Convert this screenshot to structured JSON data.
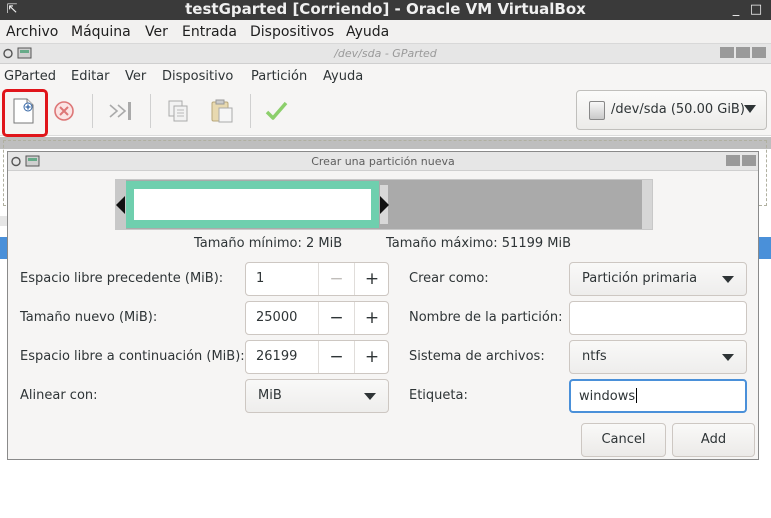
{
  "vbox": {
    "title": "testGparted [Corriendo] - Oracle VM VirtualBox",
    "menu": [
      "Archivo",
      "Máquina",
      "Ver",
      "Entrada",
      "Dispositivos",
      "Ayuda"
    ]
  },
  "gparted": {
    "title": "/dev/sda - GParted",
    "menu": [
      "GParted",
      "Editar",
      "Ver",
      "Dispositivo",
      "Partición",
      "Ayuda"
    ],
    "toolbar_icons": [
      "new-partition-icon",
      "delete-icon",
      "resize-move-icon",
      "copy-icon",
      "paste-icon",
      "apply-icon"
    ],
    "device": "/dev/sda (50.00 GiB)"
  },
  "dialog": {
    "title": "Crear una partición nueva",
    "min_size": "Tamaño mínimo: 2 MiB",
    "max_size": "Tamaño máximo: 51199 MiB",
    "left": {
      "free_before_label": "Espacio libre precedente (MiB):",
      "free_before_value": "1",
      "new_size_label": "Tamaño nuevo (MiB):",
      "new_size_value": "25000",
      "free_after_label": "Espacio libre a continuación (MiB):",
      "free_after_value": "26199",
      "align_label": "Alinear con:",
      "align_value": "MiB"
    },
    "right": {
      "create_as_label": "Crear como:",
      "create_as_value": "Partición primaria",
      "part_name_label": "Nombre de la partición:",
      "part_name_value": "",
      "filesystem_label": "Sistema de archivos:",
      "filesystem_value": "ntfs",
      "label_label": "Etiqueta:",
      "label_value": "windows"
    },
    "cancel_label": "Cancel",
    "add_label": "Add",
    "partition_fill": 0.488
  },
  "colors": {
    "new_partition": "#6fcfae",
    "highlight": "#e0151b",
    "selection": "#4a90d9"
  }
}
